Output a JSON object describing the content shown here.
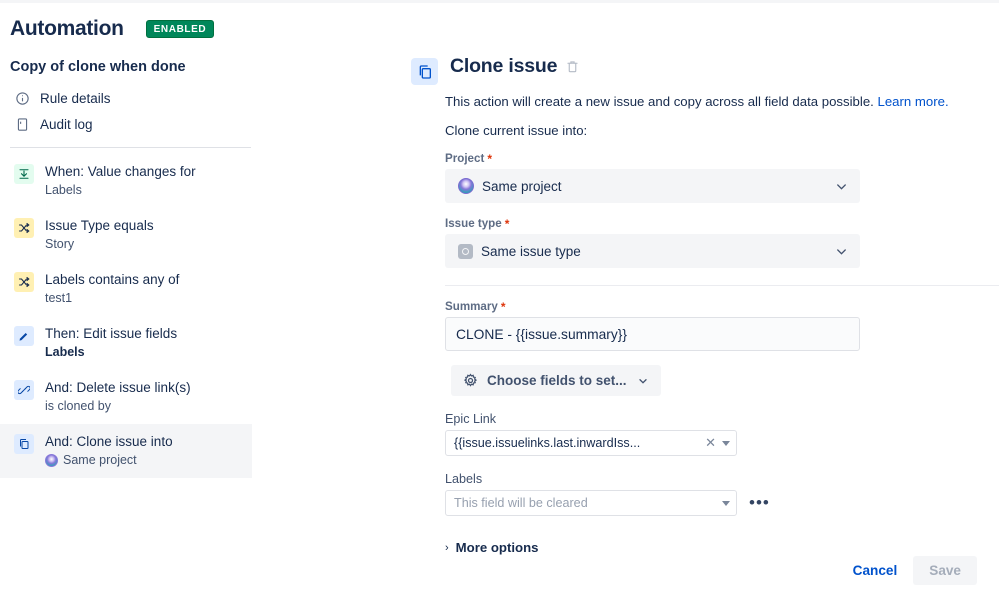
{
  "header": {
    "app_title": "Automation",
    "status_badge": "ENABLED"
  },
  "sidebar": {
    "rule_name": "Copy of clone when done",
    "nav": [
      {
        "label": "Rule details",
        "icon": "info-circle-icon"
      },
      {
        "label": "Audit log",
        "icon": "document-icon"
      }
    ],
    "steps": [
      {
        "title": "When: Value changes for",
        "sub": "Labels",
        "icon": "trigger-icon",
        "kind": "trigger",
        "selected": false,
        "bold_sub": false,
        "avatar": false
      },
      {
        "title": "Issue Type equals",
        "sub": "Story",
        "icon": "condition-icon",
        "kind": "cond",
        "selected": false,
        "bold_sub": false,
        "avatar": false
      },
      {
        "title": "Labels contains any of",
        "sub": "test1",
        "icon": "condition-icon",
        "kind": "cond",
        "selected": false,
        "bold_sub": false,
        "avatar": false
      },
      {
        "title": "Then: Edit issue fields",
        "sub": "Labels",
        "icon": "pencil-icon",
        "kind": "action",
        "selected": false,
        "bold_sub": true,
        "avatar": false
      },
      {
        "title": "And: Delete issue link(s)",
        "sub": "is cloned by",
        "icon": "broken-link-icon",
        "kind": "action",
        "selected": false,
        "bold_sub": false,
        "avatar": false
      },
      {
        "title": "And: Clone issue into",
        "sub": "Same project",
        "icon": "copy-icon",
        "kind": "action",
        "selected": true,
        "bold_sub": false,
        "avatar": true
      }
    ]
  },
  "main": {
    "title": "Clone issue",
    "title_icon": "copy-icon",
    "delete_icon": "trash-icon",
    "description": "This action will create a new issue and copy across all field data possible.",
    "learn_more": "Learn more.",
    "clone_into_text": "Clone current issue into:",
    "project": {
      "label": "Project",
      "required": true,
      "value": "Same project",
      "icon": "project-avatar"
    },
    "issue_type": {
      "label": "Issue type",
      "required": true,
      "value": "Same issue type",
      "icon": "issue-type-avatar"
    },
    "summary": {
      "label": "Summary",
      "required": true,
      "value": "CLONE - {{issue.summary}}"
    },
    "choose_fields": {
      "label": "Choose fields to set...",
      "icon": "gear-icon"
    },
    "epic_link": {
      "label": "Epic Link",
      "value": "{{issue.issuelinks.last.inwardIss...",
      "clear_icon": "close-icon",
      "caret_icon": "chevron-down-icon"
    },
    "labels": {
      "label": "Labels",
      "placeholder": "This field will be cleared",
      "more_icon": "ellipsis-icon"
    },
    "more_options": {
      "label": "More options",
      "icon": "chevron-right-icon"
    },
    "footer": {
      "cancel": "Cancel",
      "save": "Save"
    }
  },
  "colors": {
    "brand_blue": "#0052CC",
    "enabled_green": "#00875A",
    "required_red": "#DE350B",
    "text_dark": "#172B4D"
  }
}
